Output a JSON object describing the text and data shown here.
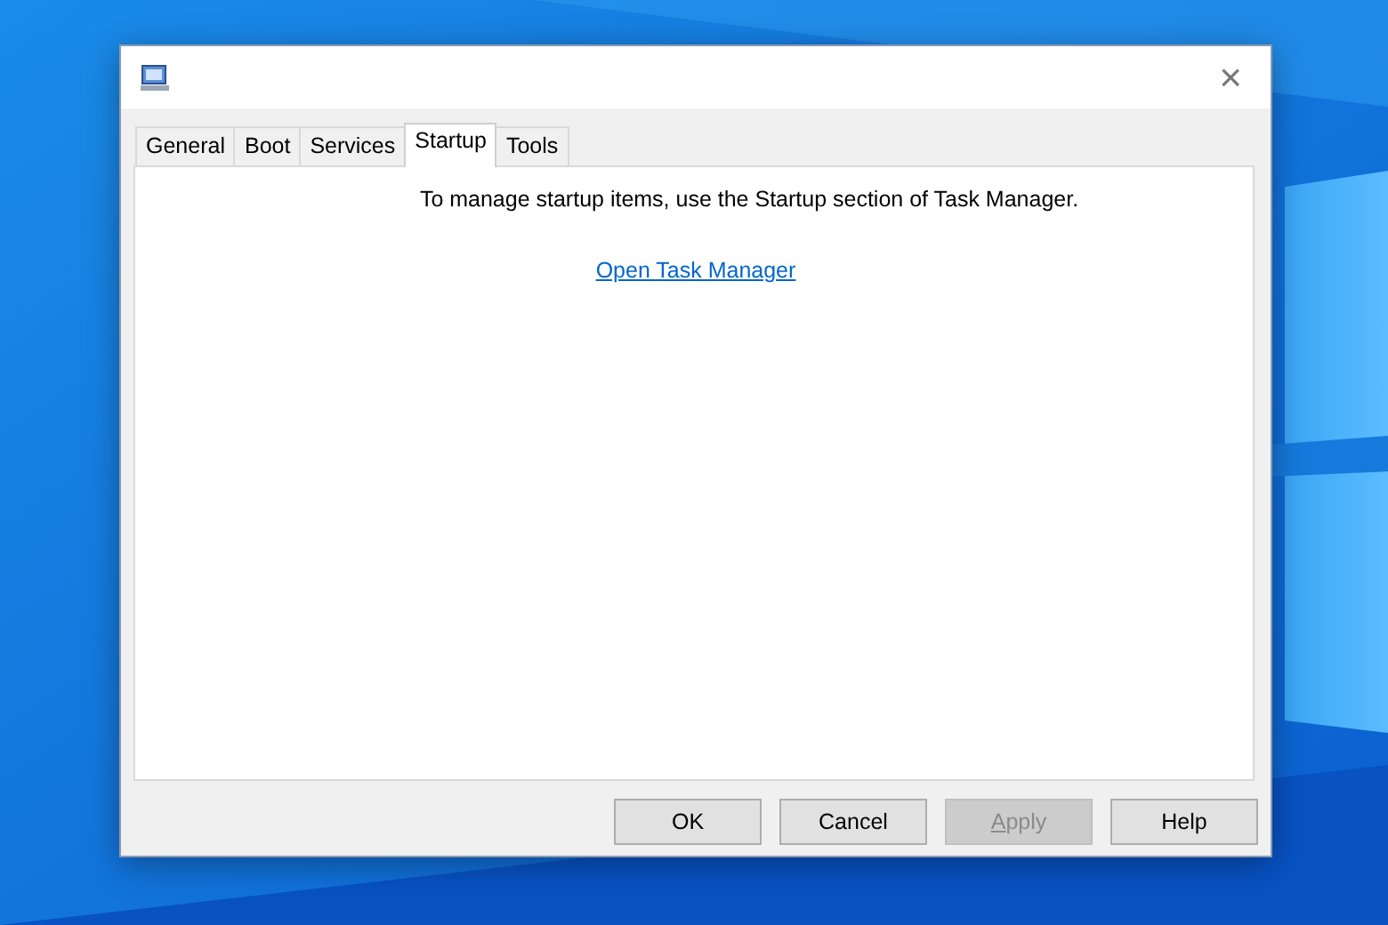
{
  "window": {
    "close": "×"
  },
  "tabs": [
    {
      "label": "General",
      "selected": false
    },
    {
      "label": "Boot",
      "selected": false
    },
    {
      "label": "Services",
      "selected": false
    },
    {
      "label": "Startup",
      "selected": true
    },
    {
      "label": "Tools",
      "selected": false
    }
  ],
  "panel": {
    "message": "To manage startup items, use the Startup section of Task Manager.",
    "link": "Open Task Manager"
  },
  "buttons": [
    {
      "label": "OK",
      "disabled": false,
      "mnemonic": false
    },
    {
      "label": "Cancel",
      "disabled": false,
      "mnemonic": false
    },
    {
      "label": "Apply",
      "disabled": true,
      "mnemonic": true
    },
    {
      "label": "Help",
      "disabled": false,
      "mnemonic": false
    }
  ]
}
